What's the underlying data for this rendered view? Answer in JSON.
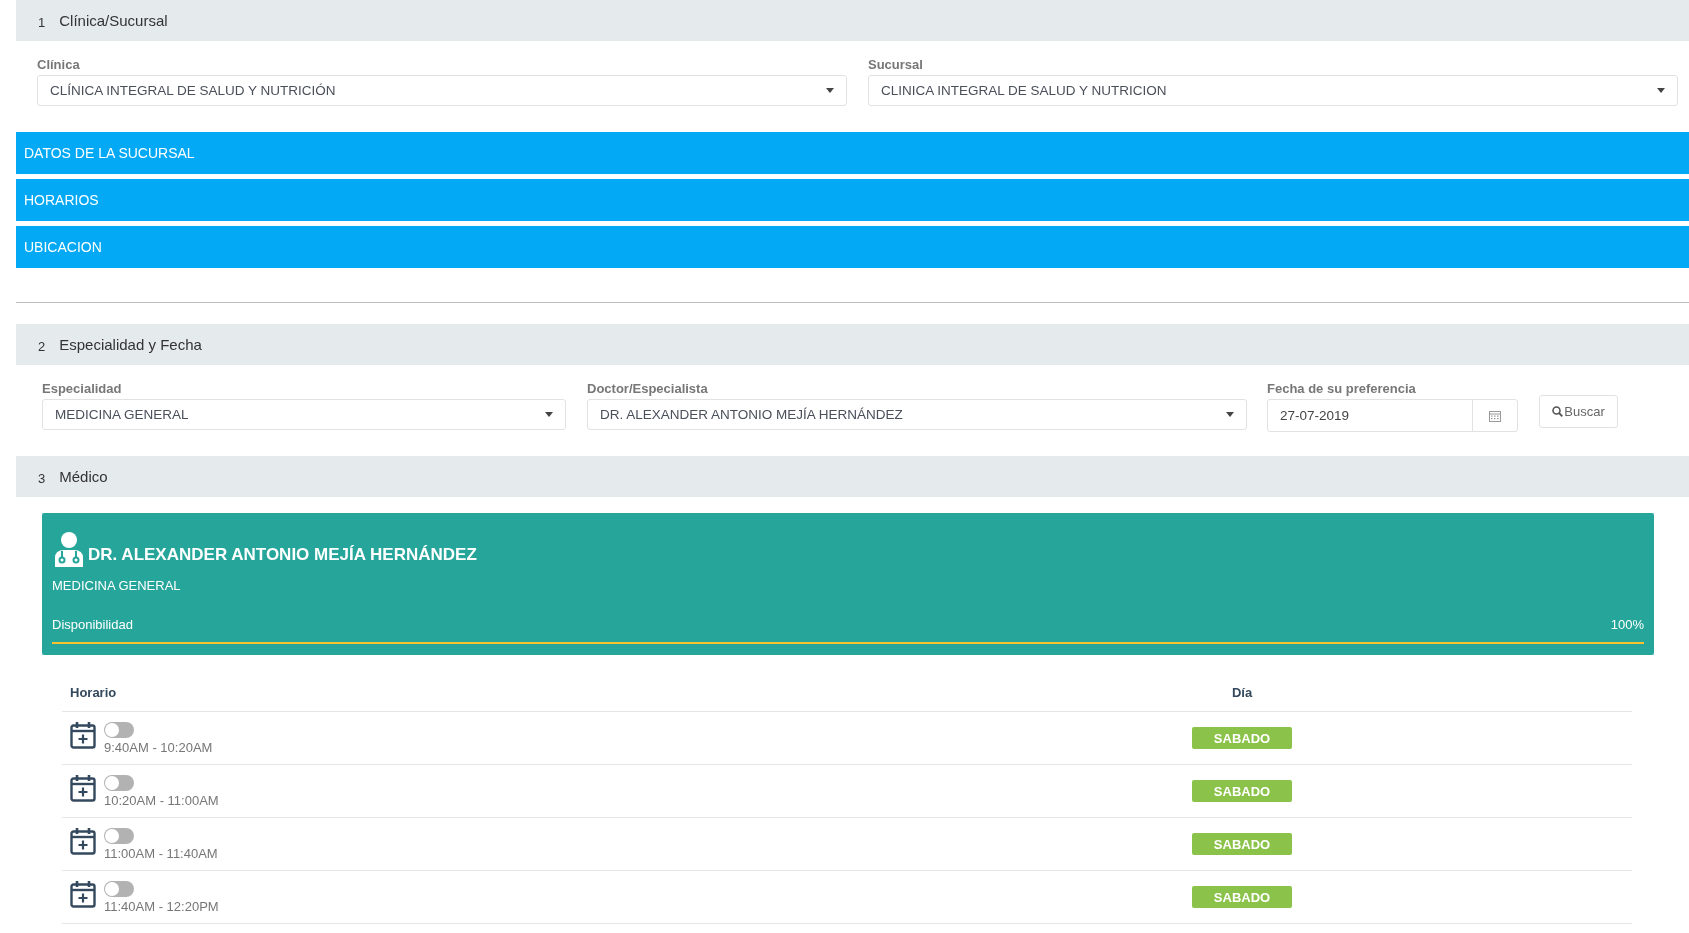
{
  "section_1": {
    "number": "1",
    "title": "Clínica/Sucursal",
    "fields": [
      {
        "label": "Clínica",
        "value": "CLÍNICA INTEGRAL DE SALUD Y NUTRICIÓN"
      },
      {
        "label": "Sucursal",
        "value": "CLINICA INTEGRAL DE SALUD Y NUTRICION"
      }
    ],
    "accordion": [
      {
        "title": "DATOS DE LA SUCURSAL",
        "expanded": false
      },
      {
        "title": "HORARIOS",
        "expanded": false
      },
      {
        "title": "UBICACION",
        "expanded": false
      }
    ]
  },
  "section_2": {
    "number": "2",
    "title": "Especialidad y Fecha",
    "especialidad": {
      "label": "Especialidad",
      "value": "MEDICINA GENERAL"
    },
    "doctor": {
      "label": "Doctor/Especialista",
      "value": "DR. ALEXANDER ANTONIO MEJÍA HERNÁNDEZ"
    },
    "fecha": {
      "label": "Fecha de su preferencia",
      "value": "27-07-2019"
    },
    "search_button": "Buscar"
  },
  "section_3": {
    "number": "3",
    "title": "Médico",
    "doctor_card": {
      "name": "DR. ALEXANDER ANTONIO MEJÍA HERNÁNDEZ",
      "specialty": "MEDICINA GENERAL",
      "availability_label": "Disponibilidad",
      "availability_reading": "100%",
      "level": 1.0
    },
    "table": {
      "columns": [
        "Horario",
        "Día"
      ],
      "rows": [
        {
          "time": "9:40AM - 10:20AM",
          "on": false,
          "day": "SABADO"
        },
        {
          "time": "10:20AM - 11:00AM",
          "on": false,
          "day": "SABADO"
        },
        {
          "time": "11:00AM - 11:40AM",
          "on": false,
          "day": "SABADO"
        },
        {
          "time": "11:40AM - 12:20PM",
          "on": false,
          "day": "SABADO"
        }
      ]
    }
  }
}
